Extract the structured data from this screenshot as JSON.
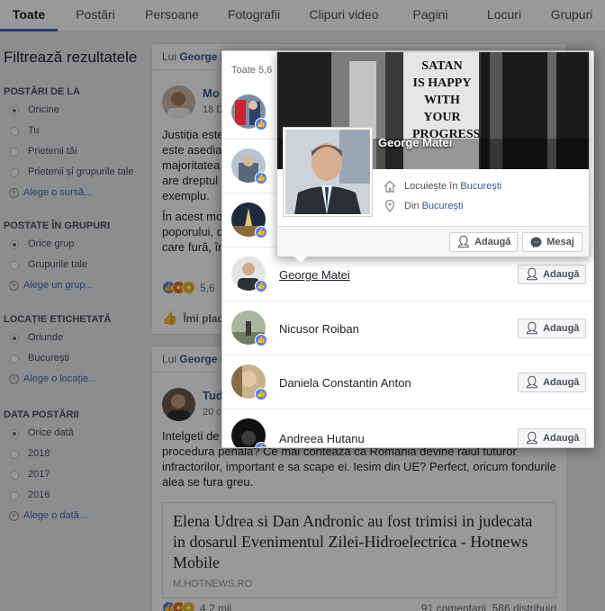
{
  "tabs": [
    "Toate",
    "Postări",
    "Persoane",
    "Fotografii",
    "Clipuri video",
    "Pagini",
    "Locuri",
    "Grupuri"
  ],
  "filters": {
    "title": "Filtrează rezultatele",
    "sections": [
      {
        "heading": "POSTĂRI DE LA",
        "options": [
          "Oricine",
          "Tu",
          "Prietenii tăi",
          "Prietenii și grupurile tale"
        ],
        "selected": 0,
        "add": "Alege o sursă..."
      },
      {
        "heading": "POSTATE ÎN GRUPURI",
        "options": [
          "Orice grup",
          "Grupurile tale"
        ],
        "selected": 0,
        "add": "Alege un grup..."
      },
      {
        "heading": "LOCAȚIE ETICHETATĂ",
        "options": [
          "Oriunde",
          "București"
        ],
        "selected": 0,
        "add": "Alege o locație..."
      },
      {
        "heading": "DATA POSTĂRII",
        "options": [
          "Orice dată",
          "2018",
          "2017",
          "2016"
        ],
        "selected": 0,
        "add": "Alege o dată..."
      }
    ]
  },
  "feed": {
    "post1": {
      "head_prefix": "Lui",
      "head_name": "George I",
      "author": "Mo",
      "date": "18 D",
      "lines": [
        "Justiția este",
        "este asedia",
        "majoritatea",
        "are dreptul",
        "exemplu."
      ],
      "lines2": [
        "În acest mo",
        "poporului, c",
        "care fură, în"
      ],
      "reaction_count": "5,6",
      "like_action": "Îmi plac"
    },
    "post2": {
      "head_prefix": "Lui",
      "head_name": "George I",
      "author": "Tud",
      "date": "20 c",
      "text_first": "Intelgeti de",
      "text": "procedura penala? Ce mai conteaza ca Romania devine raiul tuturor infractorilor, important e sa scape ei. Iesim din UE? Perfect, oricum fondurile alea se fura greu.",
      "link_title": "Elena Udrea si Dan Andronic au fost trimisi in judecata in dosarul Evenimentul Zilei-Hidroelectrica - Hotnews Mobile",
      "link_domain": "M.HOTNEWS.RO",
      "reaction_count": "4,2 mii",
      "stats": "91 comentarii  586 distribuiri"
    }
  },
  "modal": {
    "header": "Toate 5,6",
    "people": [
      {
        "name": "",
        "button": "Adaugă"
      },
      {
        "name": "",
        "button": "Adaugă"
      },
      {
        "name": "",
        "button": "Adaugă"
      },
      {
        "name": "George Matei",
        "button": "Adaugă"
      },
      {
        "name": "Nicusor Roiban",
        "button": "Adaugă"
      },
      {
        "name": "Daniela Constantin Anton",
        "button": "Adaugă"
      },
      {
        "name": "Andreea Hutanu",
        "button": "Adaugă"
      }
    ]
  },
  "hover_card": {
    "name": "George Matei",
    "lives_prefix": "Locuiește în",
    "lives_city": "București",
    "from_prefix": "Din",
    "from_city": "București",
    "add_label": "Adaugă",
    "message_label": "Mesaj",
    "cover_sign": [
      "SATAN",
      "IS HAPPY",
      "WITH YOUR",
      "PROGRESS"
    ]
  },
  "colors": {
    "accent": "#4267b2",
    "link": "#365899",
    "like_blue": "#4e7ff5"
  }
}
